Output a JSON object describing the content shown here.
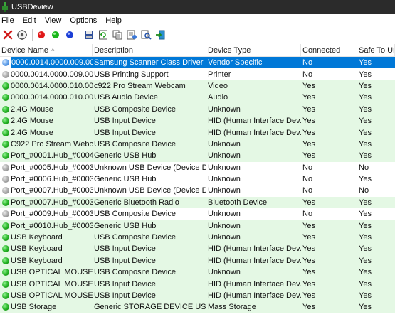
{
  "window": {
    "title": "USBDeview"
  },
  "menu": [
    "File",
    "Edit",
    "View",
    "Options",
    "Help"
  ],
  "toolbar": [
    {
      "name": "delete-icon"
    },
    {
      "name": "properties-icon"
    },
    {
      "name": "sep"
    },
    {
      "name": "red-dot-icon"
    },
    {
      "name": "green-dot-icon"
    },
    {
      "name": "blue-dot-icon"
    },
    {
      "name": "sep"
    },
    {
      "name": "save-icon"
    },
    {
      "name": "refresh-icon"
    },
    {
      "name": "copy-icon"
    },
    {
      "name": "html-report-icon"
    },
    {
      "name": "find-icon"
    },
    {
      "name": "exit-icon"
    }
  ],
  "columns": [
    "Device Name",
    "Description",
    "Device Type",
    "Connected",
    "Safe To Un"
  ],
  "rows": [
    {
      "name": "0000.0014.0000.009.00...",
      "desc": "Samsung Scanner Class Driver",
      "type": "Vendor Specific",
      "conn": "No",
      "safe": "Yes",
      "dot": "blue",
      "bg": "white",
      "selected": true
    },
    {
      "name": "0000.0014.0000.009.00...",
      "desc": "USB Printing Support",
      "type": "Printer",
      "conn": "No",
      "safe": "Yes",
      "dot": "grey",
      "bg": "white"
    },
    {
      "name": "0000.0014.0000.010.00...",
      "desc": "c922 Pro Stream Webcam",
      "type": "Video",
      "conn": "Yes",
      "safe": "Yes",
      "dot": "green",
      "bg": "green"
    },
    {
      "name": "0000.0014.0000.010.00...",
      "desc": "USB Audio Device",
      "type": "Audio",
      "conn": "Yes",
      "safe": "Yes",
      "dot": "green",
      "bg": "green"
    },
    {
      "name": "2.4G  Mouse",
      "desc": "USB Composite Device",
      "type": "Unknown",
      "conn": "Yes",
      "safe": "Yes",
      "dot": "green",
      "bg": "green"
    },
    {
      "name": "2.4G  Mouse",
      "desc": "USB Input Device",
      "type": "HID (Human Interface Dev...",
      "conn": "Yes",
      "safe": "Yes",
      "dot": "green",
      "bg": "green"
    },
    {
      "name": "2.4G  Mouse",
      "desc": "USB Input Device",
      "type": "HID (Human Interface Dev...",
      "conn": "Yes",
      "safe": "Yes",
      "dot": "green",
      "bg": "green"
    },
    {
      "name": "C922 Pro Stream Webc...",
      "desc": "USB Composite Device",
      "type": "Unknown",
      "conn": "Yes",
      "safe": "Yes",
      "dot": "green",
      "bg": "green"
    },
    {
      "name": "Port_#0001.Hub_#0004",
      "desc": "Generic USB Hub",
      "type": "Unknown",
      "conn": "Yes",
      "safe": "Yes",
      "dot": "green",
      "bg": "green"
    },
    {
      "name": "Port_#0005.Hub_#0003",
      "desc": "Unknown USB Device (Device D...",
      "type": "Unknown",
      "conn": "No",
      "safe": "No",
      "dot": "grey",
      "bg": "white"
    },
    {
      "name": "Port_#0006.Hub_#0003",
      "desc": "Generic USB Hub",
      "type": "Unknown",
      "conn": "No",
      "safe": "Yes",
      "dot": "grey",
      "bg": "white"
    },
    {
      "name": "Port_#0007.Hub_#0003",
      "desc": "Unknown USB Device (Device D...",
      "type": "Unknown",
      "conn": "No",
      "safe": "No",
      "dot": "grey",
      "bg": "white"
    },
    {
      "name": "Port_#0007.Hub_#0003",
      "desc": "Generic Bluetooth Radio",
      "type": "Bluetooth Device",
      "conn": "Yes",
      "safe": "Yes",
      "dot": "green",
      "bg": "green"
    },
    {
      "name": "Port_#0009.Hub_#0003",
      "desc": "USB Composite Device",
      "type": "Unknown",
      "conn": "No",
      "safe": "Yes",
      "dot": "grey",
      "bg": "white"
    },
    {
      "name": "Port_#0010.Hub_#0003",
      "desc": "Generic USB Hub",
      "type": "Unknown",
      "conn": "Yes",
      "safe": "Yes",
      "dot": "green",
      "bg": "green"
    },
    {
      "name": "USB Keyboard",
      "desc": "USB Composite Device",
      "type": "Unknown",
      "conn": "Yes",
      "safe": "Yes",
      "dot": "green",
      "bg": "green"
    },
    {
      "name": "USB Keyboard",
      "desc": "USB Input Device",
      "type": "HID (Human Interface Dev...",
      "conn": "Yes",
      "safe": "Yes",
      "dot": "green",
      "bg": "green"
    },
    {
      "name": "USB Keyboard",
      "desc": "USB Input Device",
      "type": "HID (Human Interface Dev...",
      "conn": "Yes",
      "safe": "Yes",
      "dot": "green",
      "bg": "green"
    },
    {
      "name": "USB OPTICAL MOUSE",
      "desc": "USB Composite Device",
      "type": "Unknown",
      "conn": "Yes",
      "safe": "Yes",
      "dot": "green",
      "bg": "green"
    },
    {
      "name": "USB OPTICAL MOUSE",
      "desc": "USB Input Device",
      "type": "HID (Human Interface Dev...",
      "conn": "Yes",
      "safe": "Yes",
      "dot": "green",
      "bg": "green"
    },
    {
      "name": "USB OPTICAL MOUSE",
      "desc": "USB Input Device",
      "type": "HID (Human Interface Dev...",
      "conn": "Yes",
      "safe": "Yes",
      "dot": "green",
      "bg": "green"
    },
    {
      "name": "USB Storage",
      "desc": "Generic STORAGE DEVICE USB ...",
      "type": "Mass Storage",
      "conn": "Yes",
      "safe": "Yes",
      "dot": "green",
      "bg": "green"
    }
  ]
}
